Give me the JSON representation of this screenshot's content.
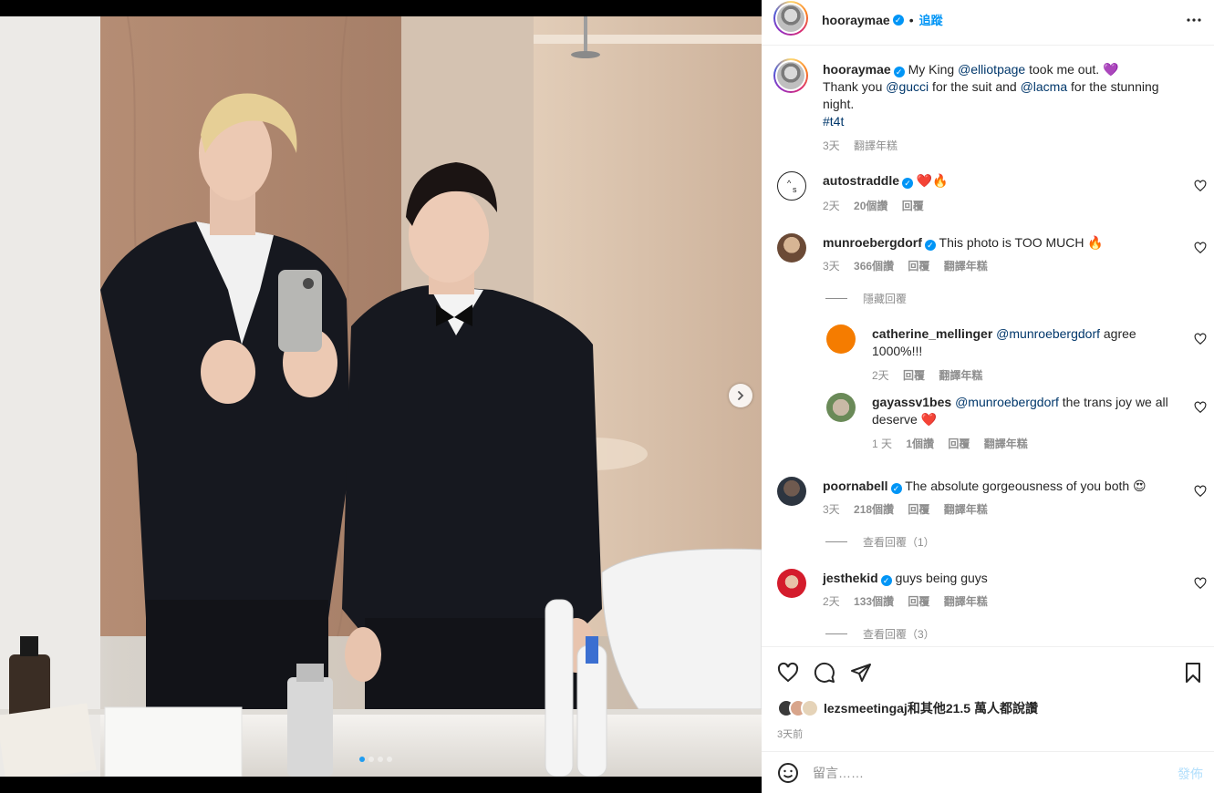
{
  "post": {
    "username": "hooraymae",
    "follow_label": "追蹤",
    "more_icon": "more-horizontal-icon",
    "caption": {
      "part1": "My King ",
      "mention1": "@elliotpage",
      "part2": " took me out. ",
      "heart": "💜",
      "line2a": "Thank you ",
      "mention2": "@gucci",
      "line2b": " for the suit and ",
      "mention3": "@lacma",
      "line2c": " for the stunning night.",
      "hashtag": "#t4t",
      "time": "3天",
      "translate": "翻譯年糕"
    }
  },
  "comments": [
    {
      "username": "autostraddle",
      "text": "❤️🔥",
      "time": "2天",
      "likes": "20個讚",
      "reply": "回覆"
    },
    {
      "username": "munroebergdorf",
      "text": "This photo is TOO MUCH 🔥",
      "time": "3天",
      "likes": "366個讚",
      "reply": "回覆",
      "translate": "翻譯年糕",
      "toggle": "隱藏回覆",
      "replies": [
        {
          "username": "catherine_mellinger",
          "mention": "@munroebergdorf",
          "text": " agree 1000%!!!",
          "time": "2天",
          "reply": "回覆",
          "translate": "翻譯年糕"
        },
        {
          "username": "gayassv1bes",
          "mention": "@munroebergdorf",
          "text": " the trans joy we all deserve ❤️",
          "time": "1 天",
          "likes": "1個讚",
          "reply": "回覆",
          "translate": "翻譯年糕"
        }
      ]
    },
    {
      "username": "poornabell",
      "text": "The absolute gorgeousness of you both 😍",
      "time": "3天",
      "likes": "218個讚",
      "reply": "回覆",
      "translate": "翻譯年糕",
      "toggle": "查看回覆（1）"
    },
    {
      "username": "jesthekid",
      "text": "guys being guys",
      "time": "2天",
      "likes": "133個讚",
      "reply": "回覆",
      "translate": "翻譯年糕",
      "toggle": "查看回覆（3）"
    }
  ],
  "footer": {
    "liked_by_user": "lezsmeetingaj",
    "liked_by_rest": "和其他21.5 萬人都說讚",
    "post_time": "3天前",
    "comment_placeholder": "留言……",
    "post_button": "發佈"
  },
  "carousel": {
    "total": 4,
    "active": 1
  },
  "colors": {
    "verified": "#0095f6",
    "link": "#00376b",
    "secondary_text": "#8e8e8e",
    "post_button_disabled": "#b2dffc",
    "carousel_dot_active": "#1f9cf0"
  },
  "icons": [
    "like-heart-icon",
    "comment-icon",
    "share-icon",
    "save-bookmark-icon",
    "emoji-icon",
    "next-chevron-icon",
    "more-horizontal-icon",
    "verified-badge-icon"
  ]
}
